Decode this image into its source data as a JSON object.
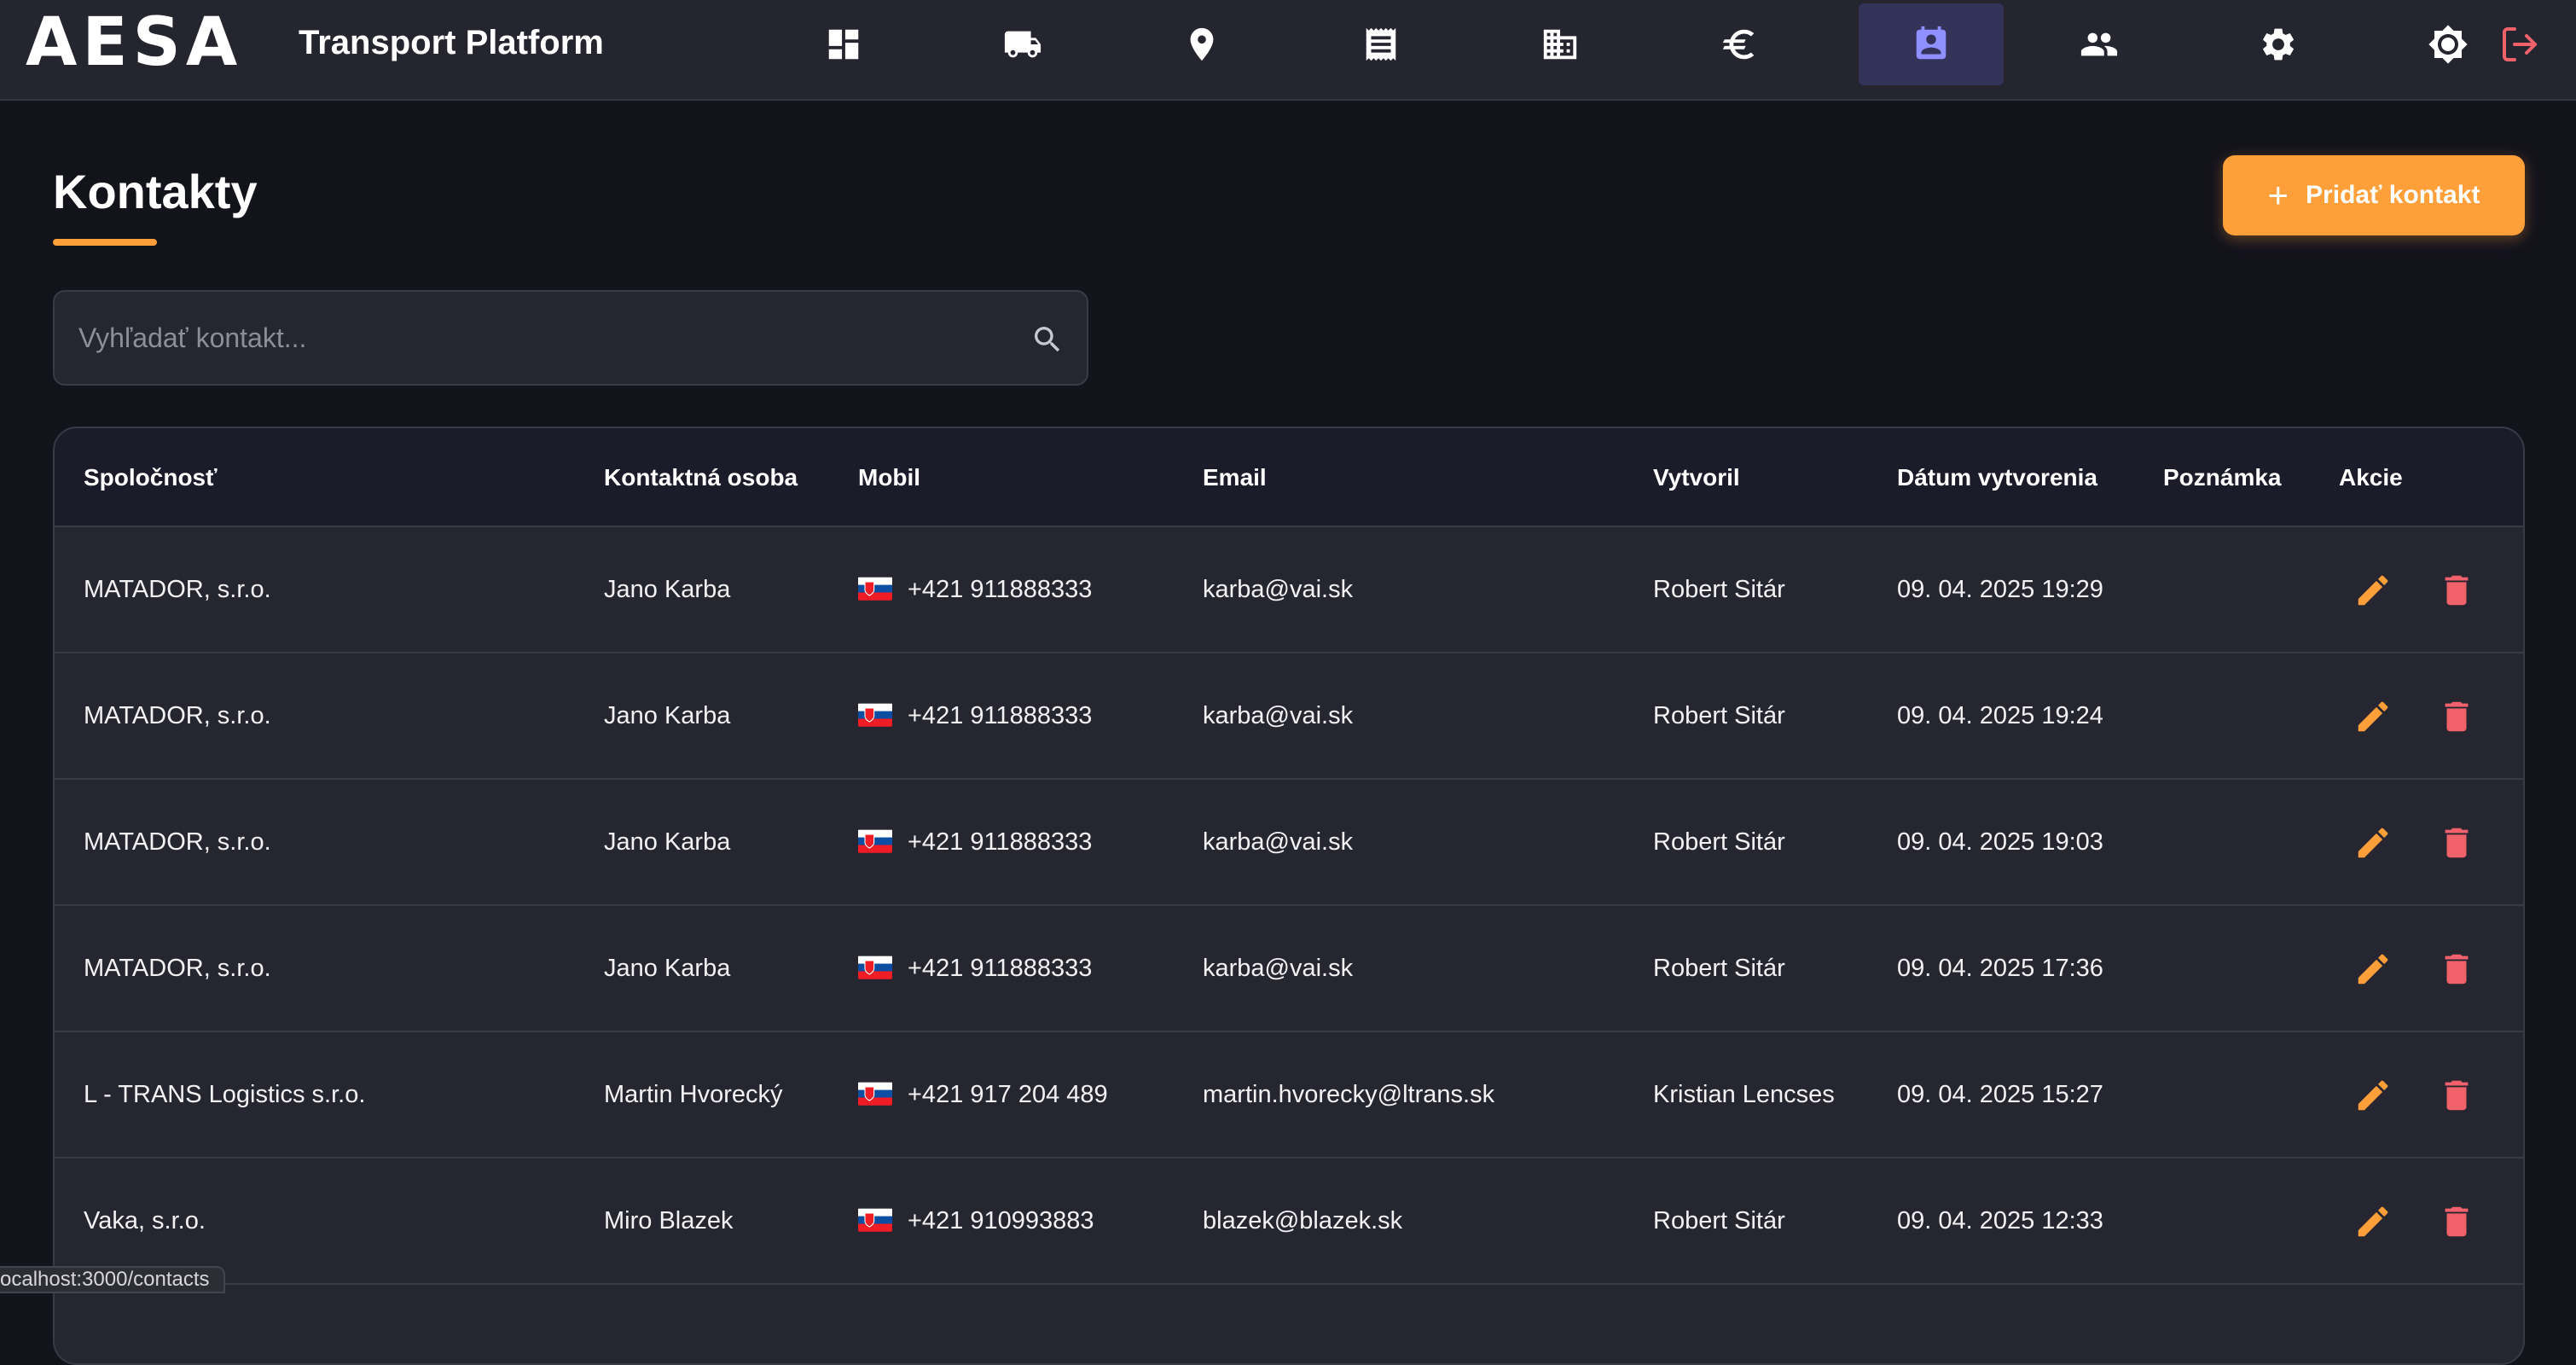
{
  "brand": {
    "logo": "AESA",
    "subtitle": "Transport Platform"
  },
  "nav": {
    "items": [
      {
        "id": "dashboard",
        "icon": "dashboard-icon"
      },
      {
        "id": "transport",
        "icon": "truck-icon"
      },
      {
        "id": "locations",
        "icon": "location-pin-icon"
      },
      {
        "id": "orders",
        "icon": "receipt-icon"
      },
      {
        "id": "companies",
        "icon": "building-icon"
      },
      {
        "id": "finance",
        "icon": "euro-icon"
      },
      {
        "id": "contacts",
        "icon": "contact-card-icon",
        "active": true
      },
      {
        "id": "users",
        "icon": "people-icon"
      },
      {
        "id": "settings",
        "icon": "gear-icon"
      }
    ],
    "theme_icon": "brightness-icon",
    "logout_icon": "logout-icon"
  },
  "page": {
    "title": "Kontakty",
    "add_button_label": "Pridať kontakt",
    "search_placeholder": "Vyhľadať kontakt..."
  },
  "table": {
    "headers": {
      "company": "Spoločnosť",
      "contact": "Kontaktná osoba",
      "mobile": "Mobil",
      "email": "Email",
      "created_by": "Vytvoril",
      "created_at": "Dátum vytvorenia",
      "note": "Poznámka",
      "actions": "Akcie"
    },
    "rows": [
      {
        "company": "MATADOR, s.r.o.",
        "contact": "Jano Karba",
        "phone": "+421 911888333",
        "email": "karba@vai.sk",
        "created_by": "Robert Sitár",
        "created_at": "09. 04. 2025 19:29",
        "note": ""
      },
      {
        "company": "MATADOR, s.r.o.",
        "contact": "Jano Karba",
        "phone": "+421 911888333",
        "email": "karba@vai.sk",
        "created_by": "Robert Sitár",
        "created_at": "09. 04. 2025 19:24",
        "note": ""
      },
      {
        "company": "MATADOR, s.r.o.",
        "contact": "Jano Karba",
        "phone": "+421 911888333",
        "email": "karba@vai.sk",
        "created_by": "Robert Sitár",
        "created_at": "09. 04. 2025 19:03",
        "note": ""
      },
      {
        "company": "MATADOR, s.r.o.",
        "contact": "Jano Karba",
        "phone": "+421 911888333",
        "email": "karba@vai.sk",
        "created_by": "Robert Sitár",
        "created_at": "09. 04. 2025 17:36",
        "note": ""
      },
      {
        "company": "L - TRANS Logistics s.r.o.",
        "contact": "Martin Hvorecký",
        "phone": "+421 917 204 489",
        "email": "martin.hvorecky@ltrans.sk",
        "created_by": "Kristian Lencses",
        "created_at": "09. 04. 2025 15:27",
        "note": ""
      },
      {
        "company": "Vaka, s.r.o.",
        "contact": "Miro Blazek",
        "phone": "+421 910993883",
        "email": "blazek@blazek.sk",
        "created_by": "Robert Sitár",
        "created_at": "09. 04. 2025 12:33",
        "note": ""
      }
    ]
  },
  "status_bar": {
    "url": "ocalhost:3000/contacts"
  },
  "colors": {
    "accent": "#ff9f3a",
    "delete": "#f0616a",
    "active_nav": "#33335a",
    "active_icon": "#8f8fff"
  }
}
